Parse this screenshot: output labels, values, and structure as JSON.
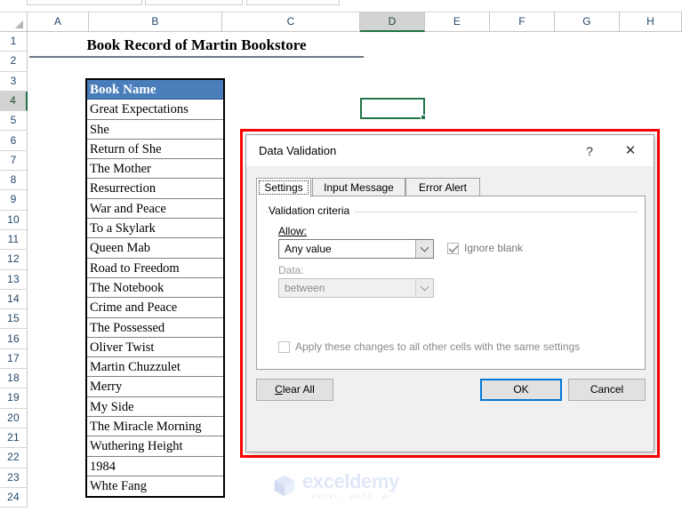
{
  "workbook": {
    "columns": [
      "A",
      "B",
      "C",
      "D",
      "E",
      "F",
      "G",
      "H"
    ],
    "selected_column": "D",
    "selected_cell": "D4",
    "rows": [
      1,
      2,
      3,
      4,
      5,
      6,
      7,
      8,
      9,
      10,
      11,
      12,
      13,
      14,
      15,
      16,
      17,
      18,
      19,
      20,
      21,
      22,
      23,
      24
    ],
    "selected_row": 4,
    "sheet_title": "Book Record of Martin Bookstore",
    "table": {
      "header": "Book Name",
      "header_bg": "#4a7ebb",
      "header_color": "#ffffff",
      "items": [
        "Great Expectations",
        "She",
        "Return of She",
        "The Mother",
        "Resurrection",
        "War and Peace",
        "To a Skylark",
        "Queen Mab",
        "Road to Freedom",
        "The Notebook",
        "Crime and Peace",
        "The Possessed",
        "Oliver Twist",
        "Martin Chuzzulet",
        "Merry",
        "My Side",
        "The Miracle Morning",
        "Wuthering Height",
        "1984",
        "Whte Fang"
      ]
    }
  },
  "dialog": {
    "title": "Data Validation",
    "help_icon": "?",
    "close_icon": "✕",
    "tabs": [
      {
        "label": "Settings",
        "active": true
      },
      {
        "label": "Input Message",
        "active": false
      },
      {
        "label": "Error Alert",
        "active": false
      }
    ],
    "group_label": "Validation criteria",
    "allow": {
      "label": "Allow:",
      "value": "Any value",
      "enabled": true
    },
    "ignore_blank": {
      "label": "Ignore blank",
      "checked": true,
      "enabled": false
    },
    "data": {
      "label": "Data:",
      "value": "between",
      "enabled": false
    },
    "apply_all": {
      "label": "Apply these changes to all other cells with the same settings",
      "checked": false,
      "enabled": false
    },
    "buttons": {
      "clear_all": "Clear All",
      "ok": "OK",
      "cancel": "Cancel",
      "focused": "OK"
    },
    "highlight_color": "#fe0000"
  },
  "watermark": {
    "name": "exceldemy",
    "tagline": "EXCEL  ·  DATA  ·  BI"
  }
}
